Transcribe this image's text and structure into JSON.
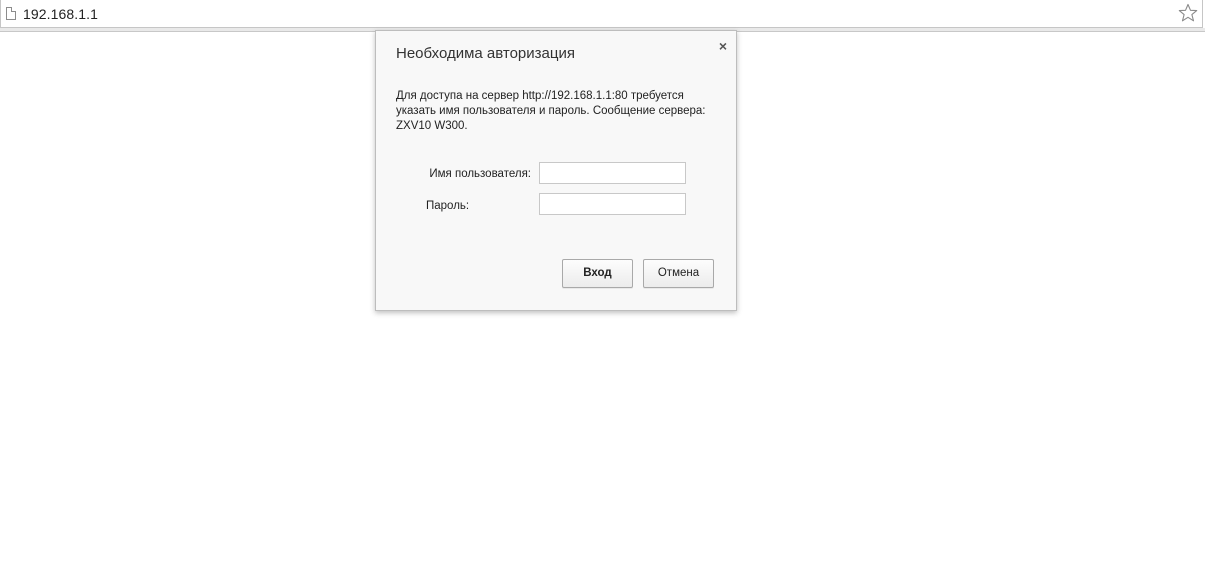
{
  "omnibox": {
    "url": "192.168.1.1",
    "page_icon": "page-icon",
    "bookmark_icon": "star-icon"
  },
  "dialog": {
    "title": "Необходима авторизация",
    "close_label": "×",
    "message": "Для доступа на сервер http://192.168.1.1:80 требуется указать имя пользователя и пароль. Сообщение сервера: ZXV10 W300.",
    "username_label": "Имя пользователя:",
    "username_value": "",
    "password_label": "Пароль:",
    "password_value": "",
    "login_label": "Вход",
    "cancel_label": "Отмена"
  }
}
